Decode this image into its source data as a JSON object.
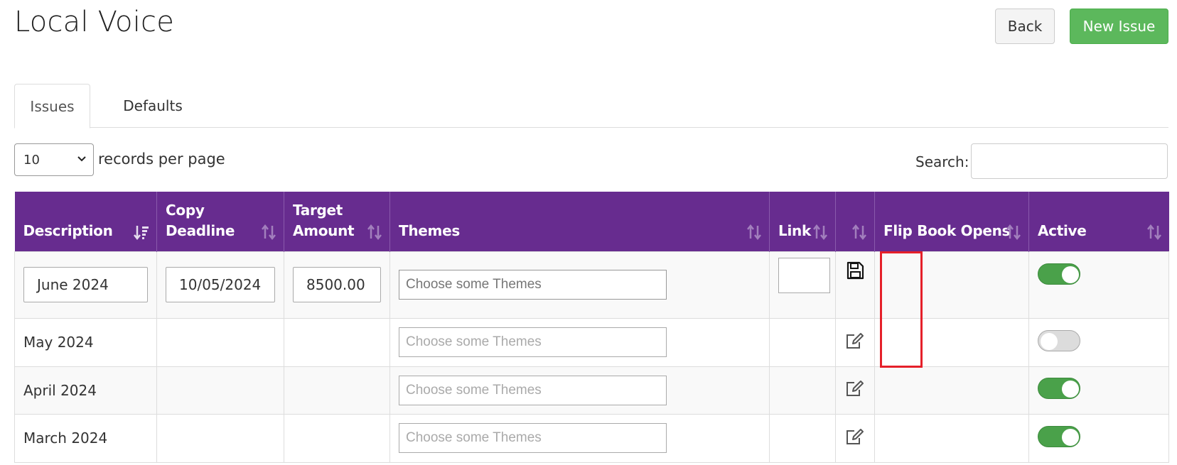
{
  "header": {
    "title": "Local Voice",
    "back_label": "Back",
    "new_issue_label": "New Issue"
  },
  "tabs": [
    {
      "label": "Issues",
      "active": true
    },
    {
      "label": "Defaults",
      "active": false
    }
  ],
  "controls": {
    "page_size_value": "10",
    "page_size_label": "records per page",
    "search_label": "Search:",
    "search_value": ""
  },
  "table": {
    "columns": [
      {
        "label_line1": "Description",
        "label_line2": "",
        "sort": "desc-active"
      },
      {
        "label_line1": "Copy",
        "label_line2": "Deadline",
        "sort": "both"
      },
      {
        "label_line1": "Target",
        "label_line2": "Amount",
        "sort": "both"
      },
      {
        "label_line1": "Themes",
        "label_line2": "",
        "sort": "both"
      },
      {
        "label_line1": "Link",
        "label_line2": "",
        "sort": "both"
      },
      {
        "label_line1": "",
        "label_line2": "",
        "sort": "both"
      },
      {
        "label_line1": "Flip Book Opens",
        "label_line2": "",
        "sort": "both"
      },
      {
        "label_line1": "Active",
        "label_line2": "",
        "sort": "both"
      }
    ],
    "themes_placeholder": "Choose some Themes",
    "edit_row": {
      "description": "June 2024",
      "copy_deadline": "10/05/2024",
      "target_amount": "8500.00",
      "link": "",
      "action_icon": "save-icon",
      "active": true
    },
    "rows": [
      {
        "description": "May 2024",
        "action_icon": "edit-icon",
        "active": false
      },
      {
        "description": "April 2024",
        "action_icon": "edit-icon",
        "active": true
      },
      {
        "description": "March 2024",
        "action_icon": "edit-icon",
        "active": true
      }
    ]
  },
  "colors": {
    "header_bg": "#672c8f",
    "new_button": "#5cb85c",
    "toggle_on": "#4aa14a",
    "highlight": "#e5202a"
  }
}
